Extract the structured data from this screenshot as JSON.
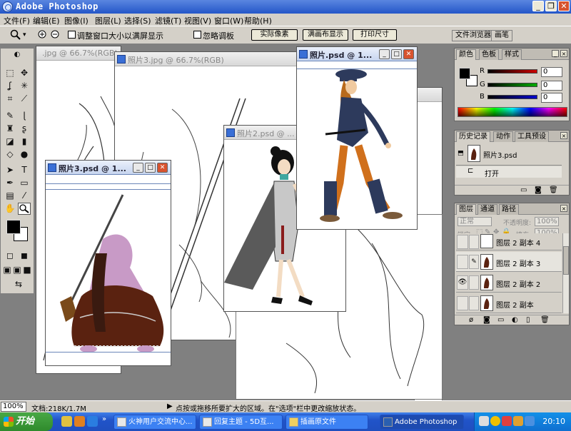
{
  "app": {
    "title": "Adobe Photoshop"
  },
  "menu": [
    "文件(F)",
    "编辑(E)",
    "图像(I)",
    "图层(L)",
    "选择(S)",
    "滤镜(T)",
    "视图(V)",
    "窗口(W)",
    "帮助(H)"
  ],
  "options": {
    "resize_windows_label": "调整窗口大小以满屏显示",
    "ignore_palettes_label": "忽略调板",
    "actual_pixels_btn": "实际像素",
    "fit_screen_btn": "满画布显示",
    "print_size_btn": "打印尺寸",
    "file_browser_tab": "文件浏览器",
    "brushes_tab": "画笔"
  },
  "documents": {
    "doc_back": {
      "title": "照片3.jpg @ 66.7%(RGB)"
    },
    "doc_back_left": {
      "title": ".jpg @ 66.7%(RGB)"
    },
    "doc_girl": {
      "title": "照片2.psd @ ..."
    },
    "doc_soldier": {
      "title": "照片3.psd @ 1..."
    },
    "doc_officer": {
      "title": "照片.psd @ 1..."
    }
  },
  "color_panel": {
    "tabs": [
      "颜色",
      "色板",
      "样式"
    ],
    "channels": [
      {
        "label": "R",
        "value": "0",
        "color": "#cc0000"
      },
      {
        "label": "G",
        "value": "0",
        "color": "#00a000"
      },
      {
        "label": "B",
        "value": "0",
        "color": "#0000cc"
      }
    ]
  },
  "history_panel": {
    "tabs": [
      "历史记录",
      "动作",
      "工具预设"
    ],
    "snapshot": "照片3.psd",
    "steps": [
      "打开"
    ]
  },
  "layers_panel": {
    "tabs": [
      "图层",
      "通道",
      "路径"
    ],
    "blend_mode": "正常",
    "opacity_label": "不透明度:",
    "opacity_value": "100%",
    "lock_label": "锁定:",
    "fill_label": "填充:",
    "fill_value": "100%",
    "layers": [
      {
        "name": "图层 2 副本 4",
        "visible": false
      },
      {
        "name": "图层 2 副本 3",
        "visible": false,
        "selected": true
      },
      {
        "name": "图层 2 副本 2",
        "visible": true
      },
      {
        "name": "图层 2 副本",
        "visible": false
      }
    ]
  },
  "status": {
    "zoom": "100%",
    "doc_size": "文档:218K/1.7M",
    "hint": "点按或拖移所要扩大的区域。在\"选项\"栏中更改缩放状态。"
  },
  "taskbar": {
    "start": "开始",
    "items": [
      "火神用户交流中心...",
      "回复主题 - 5D互...",
      "插画原文件",
      "Adobe Photoshop"
    ],
    "clock": "20:10"
  },
  "colors": {
    "title_blue": "#2456c8",
    "panel_grey": "#d4d0c8",
    "workspace_grey": "#808080"
  }
}
